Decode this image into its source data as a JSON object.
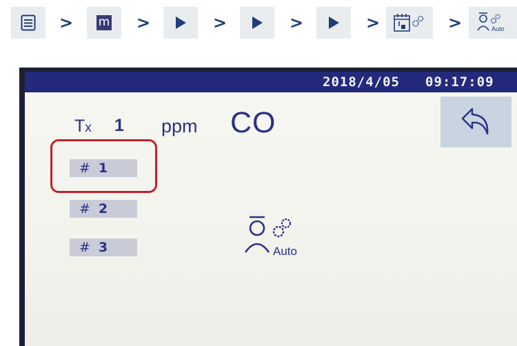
{
  "breadcrumb": {
    "separator": ">",
    "steps": [
      {
        "icon": "list-menu-icon"
      },
      {
        "icon": "m-icon",
        "label": "m"
      },
      {
        "icon": "play-icon"
      },
      {
        "icon": "play-icon"
      },
      {
        "icon": "play-icon"
      },
      {
        "icon": "calendar-gear-icon"
      },
      {
        "icon": "auto-mode-icon",
        "label": "Auto"
      }
    ]
  },
  "device": {
    "status_bar": {
      "date": "2018/4/05",
      "time": "09:17:09"
    },
    "tx": {
      "label": "T",
      "sub": "x",
      "number": "1"
    },
    "unit": "ppm",
    "gas": "CO",
    "channels": [
      {
        "hash": "#",
        "number": "1"
      },
      {
        "hash": "#",
        "number": "2"
      },
      {
        "hash": "#",
        "number": "3"
      }
    ],
    "mode_label": "Auto",
    "back_icon": "back-arrow-icon"
  },
  "colors": {
    "accent": "#2b2f86",
    "status_bar": "#232a7c",
    "highlight": "#c0202a",
    "crumb_bg": "#e9ecef"
  }
}
